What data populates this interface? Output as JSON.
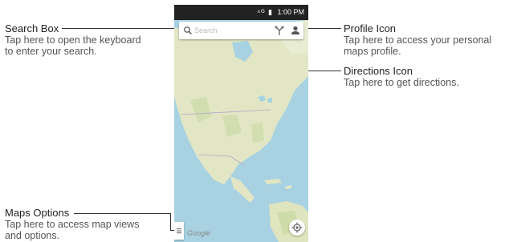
{
  "callouts": {
    "search_box": {
      "title": "Search Box",
      "desc": "Tap here to open the keyboard\nto enter your search."
    },
    "profile_icon": {
      "title": "Profile Icon",
      "desc": "Tap here to access your personal\nmaps profile."
    },
    "directions_icon": {
      "title": "Directions Icon",
      "desc": "Tap here to get directions."
    },
    "maps_options": {
      "title": "Maps Options",
      "desc": "Tap here to access map views\nand options."
    }
  },
  "phone": {
    "status_icons": "⁴ᴳ ▮",
    "time": "1:00 PM",
    "search_placeholder": "Search",
    "google_logo": "Google",
    "icons": {
      "search": "search-icon",
      "directions": "directions-icon",
      "profile": "profile-icon",
      "menu": "menu-icon",
      "location": "my-location-icon"
    }
  },
  "colors": {
    "water": "#a8d2e2",
    "land": "#e4e8c8",
    "statusbar": "#222222"
  }
}
